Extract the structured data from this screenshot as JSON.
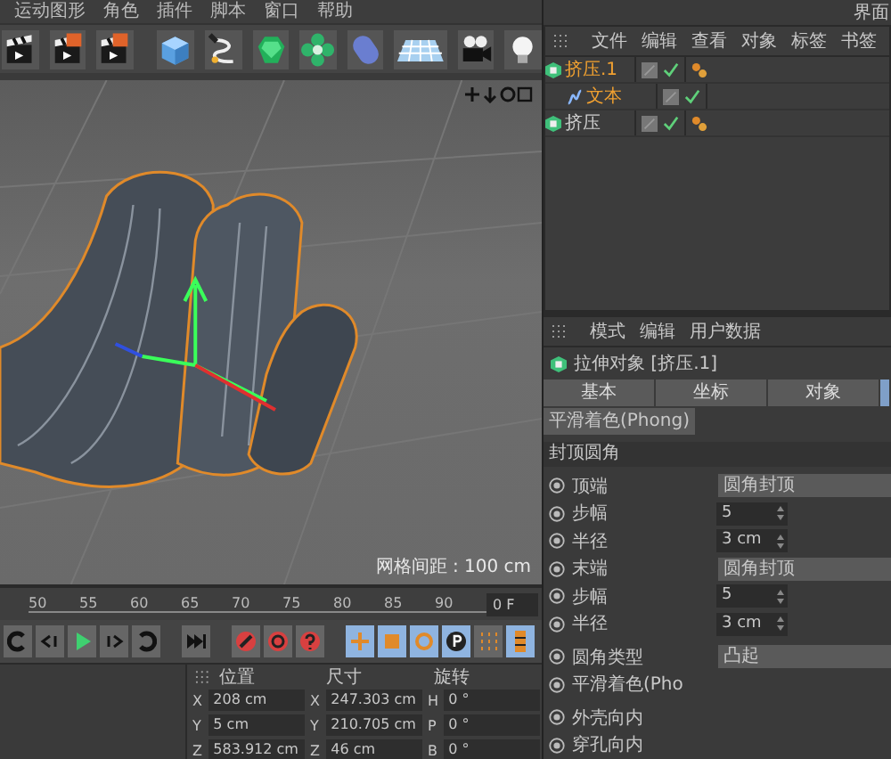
{
  "menu_bar": [
    "运动图形",
    "角色",
    "插件",
    "脚本",
    "窗口",
    "帮助"
  ],
  "layout_label": "界面",
  "viewport": {
    "grid_spacing": "网格间距 : 100 cm"
  },
  "timeline": {
    "ticks": [
      "50",
      "55",
      "60",
      "65",
      "70",
      "75",
      "80",
      "85",
      "90"
    ],
    "frame": "0 F"
  },
  "object_manager": {
    "menu": [
      "文件",
      "编辑",
      "查看",
      "对象",
      "标签",
      "书签"
    ],
    "objects": [
      {
        "name": "挤压.1",
        "selected": true,
        "children": [
          {
            "name": "文本",
            "selected": true
          }
        ]
      },
      {
        "name": "挤压",
        "selected": false
      }
    ]
  },
  "attributes": {
    "menu": [
      "模式",
      "编辑",
      "用户数据"
    ],
    "title": "拉伸对象 [挤压.1]",
    "tabs": [
      {
        "label": "基本",
        "selected": false
      },
      {
        "label": "坐标",
        "selected": false
      },
      {
        "label": "对象",
        "selected": false
      },
      {
        "selected": true
      }
    ],
    "subtab": "平滑着色(Phong)",
    "section": "封顶圆角",
    "param_groups": [
      [
        {
          "kind": "dropdown",
          "label": "顶端",
          "value": "圆角封顶"
        },
        {
          "kind": "number",
          "label": "步幅",
          "value": "5"
        },
        {
          "kind": "number",
          "label": "半径",
          "value": "3 cm"
        },
        {
          "kind": "dropdown",
          "label": "末端",
          "value": "圆角封顶"
        },
        {
          "kind": "number",
          "label": "步幅",
          "value": "5"
        },
        {
          "kind": "number",
          "label": "半径",
          "value": "3 cm"
        }
      ],
      [
        {
          "kind": "dropdown",
          "label": "圆角类型",
          "value": "凸起"
        },
        {
          "kind": "label",
          "label": "平滑着色(Pho"
        }
      ],
      [
        {
          "kind": "label",
          "label": "外壳向内"
        },
        {
          "kind": "label",
          "label": "穿孔向内"
        }
      ]
    ]
  },
  "coordinates": {
    "headers": [
      "位置",
      "尺寸",
      "旋转"
    ],
    "rows": [
      [
        {
          "axis": "X",
          "value": "208 cm"
        },
        {
          "axis": "X",
          "value": "247.303 cm"
        },
        {
          "axis": "H",
          "value": "0 °"
        }
      ],
      [
        {
          "axis": "Y",
          "value": "5 cm"
        },
        {
          "axis": "Y",
          "value": "210.705 cm"
        },
        {
          "axis": "P",
          "value": "0 °"
        }
      ],
      [
        {
          "axis": "Z",
          "value": "583.912 cm"
        },
        {
          "axis": "Z",
          "value": "46 cm"
        },
        {
          "axis": "B",
          "value": "0 °"
        }
      ]
    ]
  }
}
